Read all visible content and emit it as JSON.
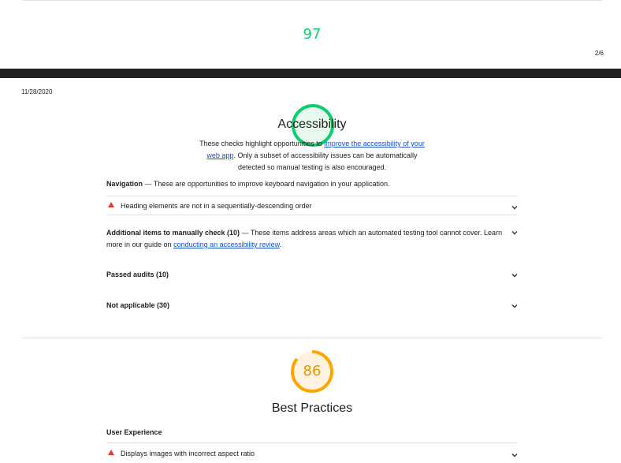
{
  "colors": {
    "pass": "#0cce6b",
    "average": "#ffa400",
    "fail": "#e53935",
    "link": "#1a4fc4"
  },
  "prev_page": {
    "score": "97",
    "page_number": "2/6"
  },
  "page": {
    "date": "11/28/2020"
  },
  "accessibility": {
    "score": 100,
    "title": "Accessibility",
    "desc_pre": "These checks highlight opportunities to ",
    "desc_link_1": "improve the accessibility of your",
    "desc_link_2": "web app",
    "desc_post_1": ". Only a subset of accessibility issues can be automatically",
    "desc_post_2": "detected so manual testing is also encouraged.",
    "navigation_title": "Navigation",
    "navigation_desc": " — These are opportunities to improve keyboard navigation in your application.",
    "audit_heading": "Heading elements are not in a sequentially-descending order",
    "manual_title": "Additional items to manually check (10)",
    "manual_desc_1": " — These items address areas which an automated testing tool cannot cover. Learn",
    "manual_desc_2": "more in our guide on ",
    "manual_link": "conducting an accessibility review",
    "manual_desc_3": ".",
    "passed": "Passed audits (10)",
    "not_applicable": "Not applicable (30)"
  },
  "best_practices": {
    "score": "86",
    "score_value": 86,
    "title": "Best Practices",
    "group_title": "User Experience",
    "audit_aspect": "Displays images with incorrect aspect ratio"
  },
  "icons": [
    "chevron-down-icon",
    "warning-triangle-icon",
    "score-gauge"
  ]
}
